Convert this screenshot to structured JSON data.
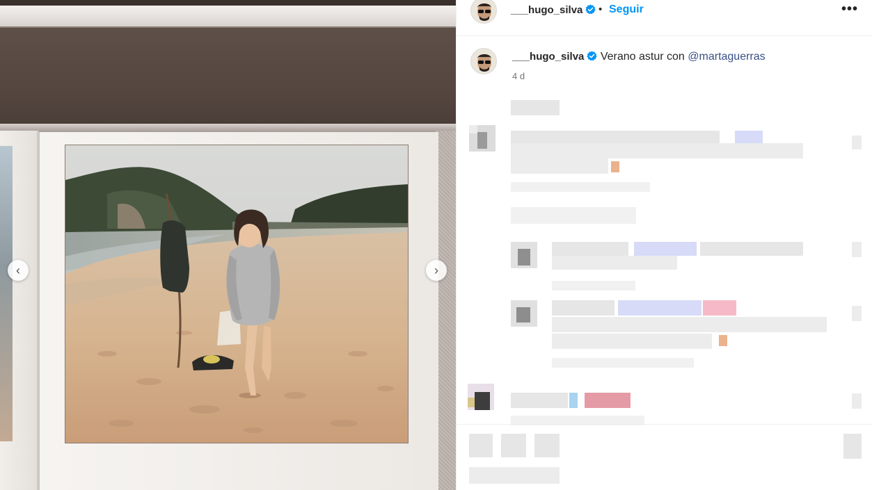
{
  "post": {
    "username": "___hugo_silva",
    "follow_label": "Seguir",
    "separator": "•",
    "more_label": "•••",
    "caption_text": "Verano astur con",
    "caption_mention": "@martaguerras",
    "timestamp": "4 d"
  },
  "carousel": {
    "prev_label": "‹",
    "next_label": "›"
  },
  "icons": {
    "verified": "verified-badge-icon",
    "more": "more-options-icon",
    "prev": "chevron-left-icon",
    "next": "chevron-right-icon"
  },
  "colors": {
    "follow": "#0095f6",
    "verified": "#0095f6",
    "mention": "#385185",
    "timestamp": "#737373"
  }
}
